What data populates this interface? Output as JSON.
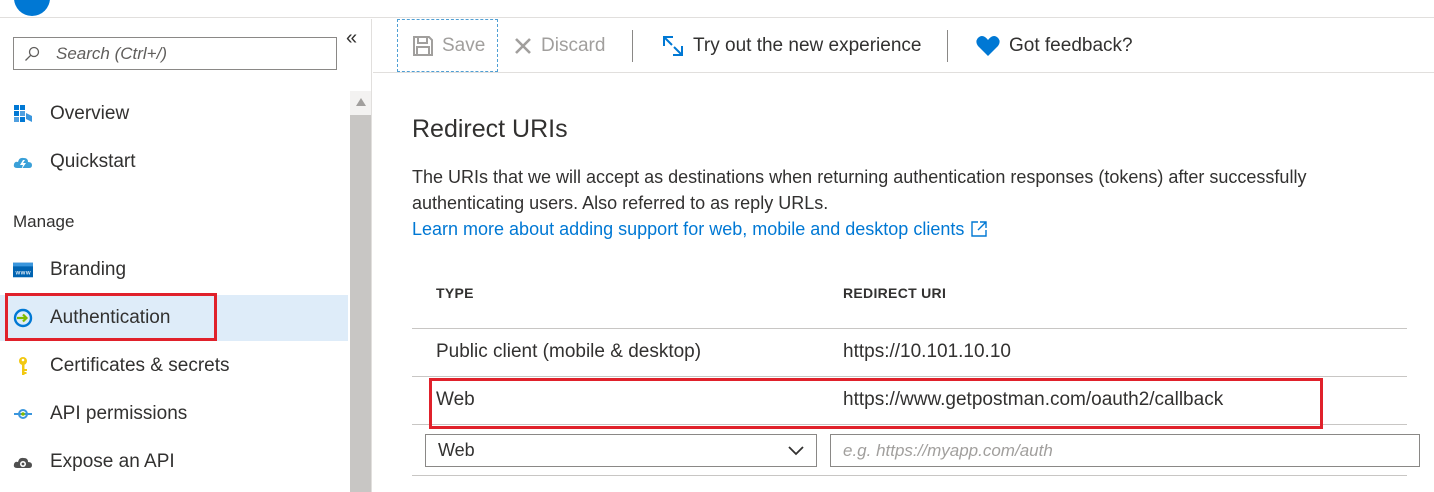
{
  "sidebar": {
    "search_placeholder": "Search (Ctrl+/)",
    "collapse_glyph": "«",
    "items": [
      {
        "label": "Overview",
        "icon": "grid-icon"
      },
      {
        "label": "Quickstart",
        "icon": "cloud-bolt-icon"
      },
      {
        "label": "Branding",
        "icon": "www-icon"
      },
      {
        "label": "Authentication",
        "icon": "auth-arrow-icon",
        "selected": true
      },
      {
        "label": "Certificates & secrets",
        "icon": "key-icon"
      },
      {
        "label": "API permissions",
        "icon": "permissions-icon"
      },
      {
        "label": "Expose an API",
        "icon": "cloud-gear-icon"
      }
    ],
    "section_manage": "Manage"
  },
  "toolbar": {
    "save_label": "Save",
    "discard_label": "Discard",
    "try_label": "Try out the new experience",
    "feedback_label": "Got feedback?"
  },
  "content": {
    "title": "Redirect URIs",
    "description": "The URIs that we will accept as destinations when returning authentication responses (tokens) after successfully authenticating users. Also referred to as reply URLs.",
    "learn_more": "Learn more about adding support for web, mobile and desktop clients"
  },
  "table": {
    "headers": [
      "TYPE",
      "REDIRECT URI"
    ],
    "rows": [
      {
        "type": "Public client (mobile & desktop)",
        "uri": "https://10.101.10.10"
      },
      {
        "type": "Web",
        "uri": "https://www.getpostman.com/oauth2/callback"
      }
    ],
    "new_row": {
      "type_value": "Web",
      "uri_placeholder": "e.g. https://myapp.com/auth"
    }
  },
  "colors": {
    "accent": "#0078d4",
    "highlight_red": "#e0212b",
    "selected_bg": "#deecf9"
  }
}
